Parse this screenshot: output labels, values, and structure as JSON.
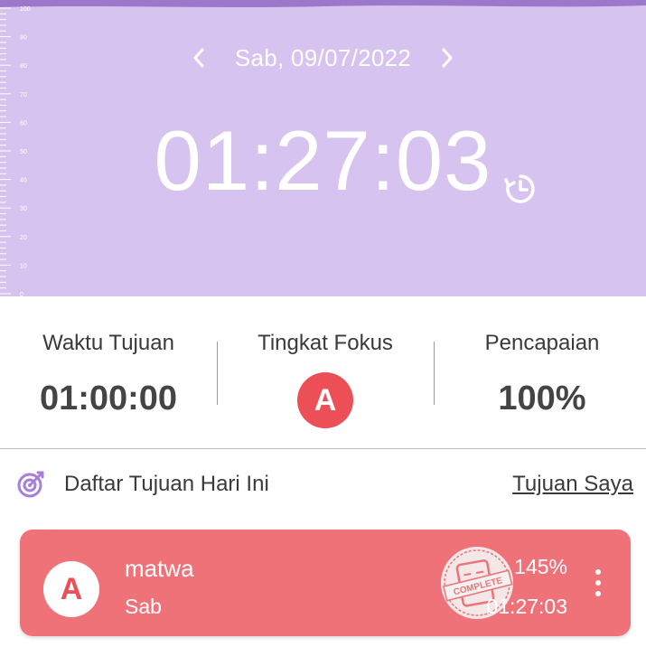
{
  "timer": {
    "date": "Sab, 09/07/2022",
    "elapsed": "01:27:03",
    "ruler_labels": [
      "100",
      "90",
      "80",
      "70",
      "60",
      "50",
      "40",
      "30",
      "20",
      "10",
      "0"
    ]
  },
  "stats": {
    "goal_time_label": "Waktu Tujuan",
    "goal_time_value": "01:00:00",
    "focus_label": "Tingkat Fokus",
    "focus_grade": "A",
    "achievement_label": "Pencapaian",
    "achievement_value": "100%"
  },
  "goals": {
    "title": "Daftar Tujuan Hari Ini",
    "link": "Tujuan Saya",
    "items": [
      {
        "grade": "A",
        "name": "matwa",
        "day": "Sab",
        "percent": "145%",
        "time": "01:27:03",
        "stamp": "COMPLETE"
      }
    ]
  },
  "colors": {
    "header_bg": "#d7c3ef",
    "header_wave": "#9b78c9",
    "accent_red": "#ec4f56",
    "card_bg": "#ef7279",
    "target_icon": "#a77fd6"
  },
  "icons": {
    "prev": "chevron-left-icon",
    "next": "chevron-right-icon",
    "history": "clock-history-icon",
    "target": "target-icon",
    "menu": "more-vert-icon"
  }
}
